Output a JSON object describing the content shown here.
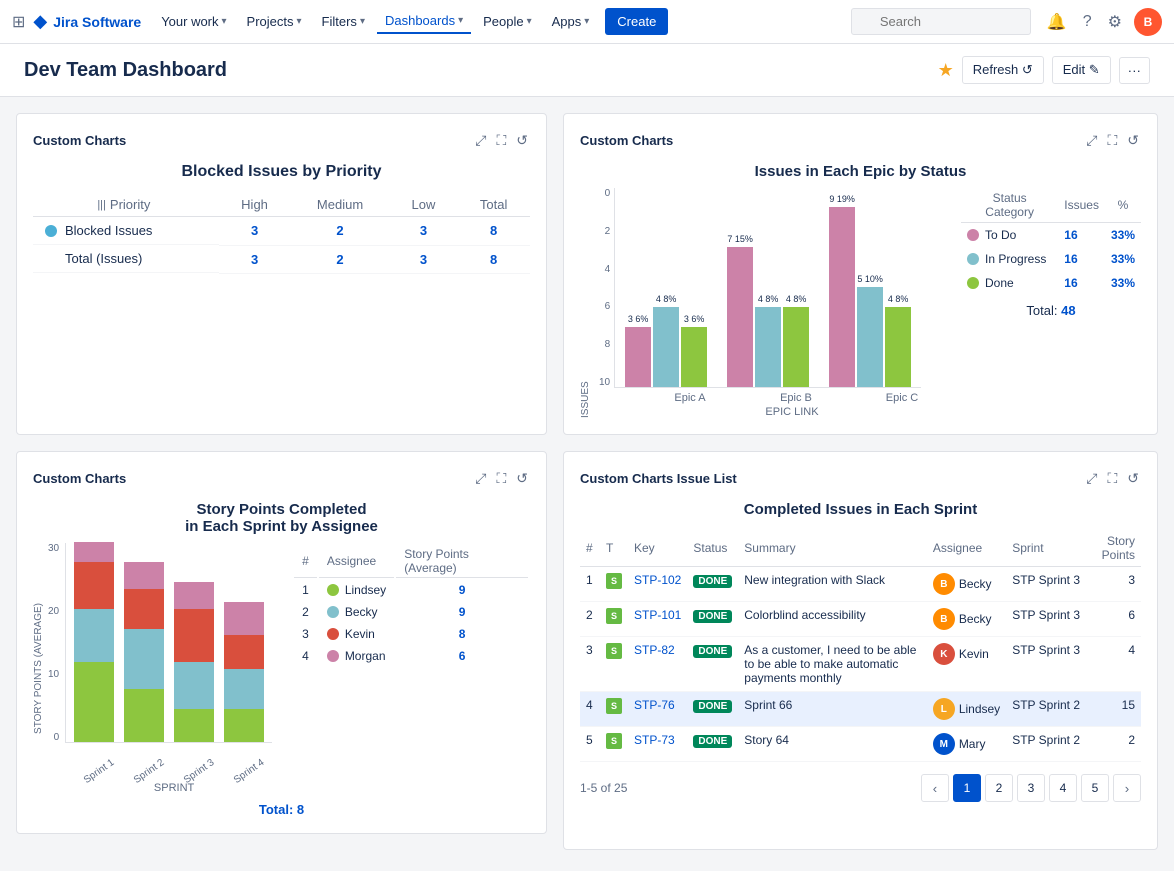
{
  "app": {
    "name": "Jira Software",
    "logo_char": "◆"
  },
  "nav": {
    "grid_icon": "⊞",
    "your_work": "Your work",
    "projects": "Projects",
    "filters": "Filters",
    "dashboards": "Dashboards",
    "people": "People",
    "apps": "Apps",
    "create": "Create",
    "search_placeholder": "Search",
    "avatar_initials": "B"
  },
  "page": {
    "title": "Dev Team Dashboard",
    "refresh_label": "Refresh ↺",
    "edit_label": "Edit ✎"
  },
  "blocked_chart": {
    "card_title": "Custom Charts",
    "title": "Blocked Issues by Priority",
    "col_priority": "Priority",
    "col_high": "High",
    "col_medium": "Medium",
    "col_low": "Low",
    "col_total": "Total",
    "rows": [
      {
        "label": "Blocked Issues",
        "dot_color": "#4bafd6",
        "high": "3",
        "medium": "2",
        "low": "3",
        "total": "8"
      },
      {
        "label": "Total (Issues)",
        "dot_color": null,
        "high": "3",
        "medium": "2",
        "low": "3",
        "total": "8"
      }
    ]
  },
  "story_points_chart": {
    "card_title": "Custom Charts",
    "title": "Story Points Completed",
    "title2": "in Each Sprint by Assignee",
    "y_label": "STORY POINTS (AVERAGE)",
    "x_label": "SPRINT",
    "total_label": "Total:",
    "total_value": "8",
    "y_ticks": [
      "0",
      "10",
      "20",
      "30"
    ],
    "sprints": [
      "Sprint 1",
      "Sprint 2",
      "Sprint 3",
      "Sprint 4"
    ],
    "assignees": [
      {
        "num": 1,
        "name": "Lindsey",
        "color": "#8dc63f",
        "points": 9,
        "segments": [
          12,
          8,
          5,
          5
        ]
      },
      {
        "num": 2,
        "name": "Becky",
        "color": "#81c0cc",
        "points": 9,
        "segments": [
          8,
          9,
          7,
          6
        ]
      },
      {
        "num": 3,
        "name": "Kevin",
        "color": "#d94f3d",
        "points": 8,
        "segments": [
          7,
          6,
          8,
          5
        ]
      },
      {
        "num": 4,
        "name": "Morgan",
        "color": "#cc82a8",
        "points": 6,
        "segments": [
          3,
          4,
          4,
          5
        ]
      }
    ]
  },
  "epic_chart": {
    "card_title": "Custom Charts",
    "title": "Issues in Each Epic by Status",
    "y_label": "ISSUES",
    "x_label": "EPIC LINK",
    "total_label": "Total:",
    "total_value": "48",
    "y_ticks": [
      "0",
      "2",
      "4",
      "6",
      "8",
      "10"
    ],
    "epics": [
      {
        "name": "Epic A",
        "todo": {
          "count": 3,
          "pct": "6%"
        },
        "inprogress": {
          "count": 4,
          "pct": "8%"
        },
        "done": {
          "count": 3,
          "pct": "6%"
        }
      },
      {
        "name": "Epic B",
        "todo": {
          "count": 7,
          "pct": "15%"
        },
        "inprogress": {
          "count": 4,
          "pct": "8%"
        },
        "done": {
          "count": 4,
          "pct": "8%"
        }
      },
      {
        "name": "Epic C",
        "todo": {
          "count": 9,
          "pct": "19%"
        },
        "inprogress": {
          "count": 5,
          "pct": "10%"
        },
        "done": {
          "count": 4,
          "pct": "8%"
        }
      }
    ],
    "legend": [
      {
        "label": "To Do",
        "color": "#cc82a8",
        "issues": "16",
        "pct": "33%"
      },
      {
        "label": "In Progress",
        "color": "#81c0cc",
        "issues": "16",
        "pct": "33%"
      },
      {
        "label": "Done",
        "color": "#8dc63f",
        "issues": "16",
        "pct": "33%"
      }
    ]
  },
  "issue_list": {
    "card_title": "Custom Charts Issue List",
    "title": "Completed Issues in Each Sprint",
    "col_num": "#",
    "col_type": "T",
    "col_key": "Key",
    "col_status": "Status",
    "col_summary": "Summary",
    "col_assignee": "Assignee",
    "col_sprint": "Sprint",
    "col_story_points": "Story Points",
    "rows": [
      {
        "num": 1,
        "key": "STP-102",
        "status": "DONE",
        "summary": "New integration with Slack",
        "assignee": "Becky",
        "assignee_color": "#ff8b00",
        "assignee_initial": "B",
        "sprint": "STP Sprint 3",
        "story_points": "3",
        "highlighted": false
      },
      {
        "num": 2,
        "key": "STP-101",
        "status": "DONE",
        "summary": "Colorblind accessibility",
        "assignee": "Becky",
        "assignee_color": "#ff8b00",
        "assignee_initial": "B",
        "sprint": "STP Sprint 3",
        "story_points": "6",
        "highlighted": false
      },
      {
        "num": 3,
        "key": "STP-82",
        "status": "DONE",
        "summary": "As a customer, I need to be able to be able to make automatic payments monthly",
        "assignee": "Kevin",
        "assignee_color": "#d94f3d",
        "assignee_initial": "K",
        "sprint": "STP Sprint 3",
        "story_points": "4",
        "highlighted": false
      },
      {
        "num": 4,
        "key": "STP-76",
        "status": "DONE",
        "summary": "Sprint 66",
        "assignee": "Lindsey",
        "assignee_color": "#f6a623",
        "assignee_initial": "L",
        "sprint": "STP Sprint 2",
        "story_points": "15",
        "highlighted": true
      },
      {
        "num": 5,
        "key": "STP-73",
        "status": "DONE",
        "summary": "Story 64",
        "assignee": "Mary",
        "assignee_color": "#0052cc",
        "assignee_initial": "M",
        "sprint": "STP Sprint 2",
        "story_points": "2",
        "highlighted": false
      }
    ],
    "pagination": {
      "showing": "1-5",
      "total": "25",
      "pages": [
        "1",
        "2",
        "3",
        "4",
        "5"
      ]
    }
  }
}
